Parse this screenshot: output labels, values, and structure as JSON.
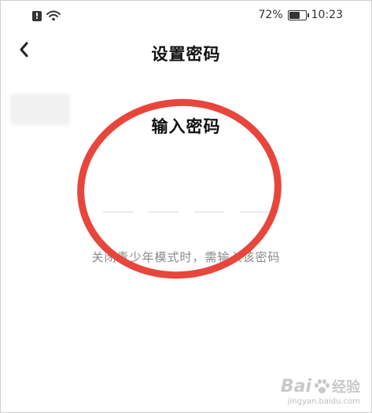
{
  "status_bar": {
    "alert_glyph": "!",
    "icons": [
      "alert-icon",
      "wifi-icon",
      "battery-icon"
    ],
    "battery_percent": "72%",
    "battery_level": 0.72,
    "time": "10:23"
  },
  "nav": {
    "back_icon": "chevron-left-icon",
    "title": "设置密码"
  },
  "main": {
    "heading": "输入密码",
    "digit_count": 4,
    "hint": "关闭青少年模式时，需输入该密码"
  },
  "annotation": {
    "color": "#e8463c"
  },
  "watermark": {
    "logo_prefix": "Bai",
    "logo_suffix": "经验",
    "url": "jingyan.baidu.com"
  }
}
